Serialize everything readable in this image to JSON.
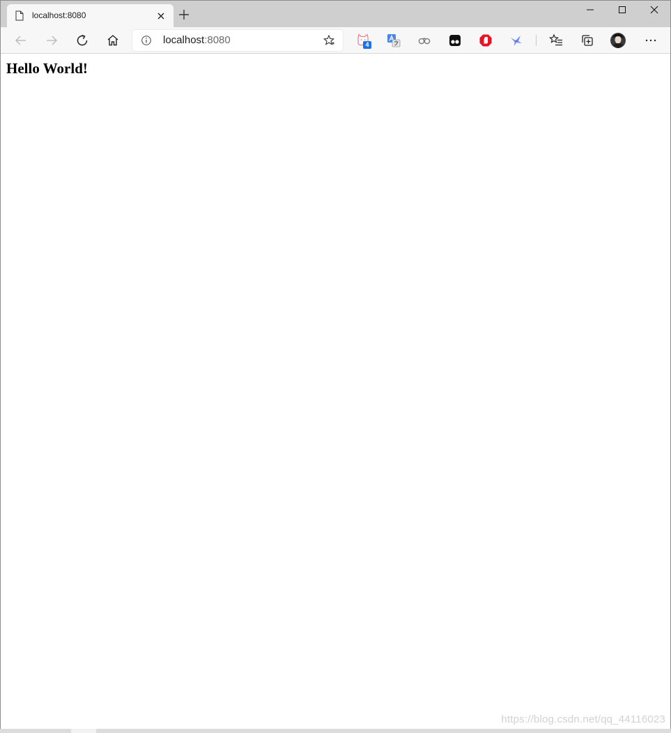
{
  "tab": {
    "title": "localhost:8080"
  },
  "address_bar": {
    "host": "localhost",
    "port": ":8080"
  },
  "extensions": {
    "badge_count": "4"
  },
  "page": {
    "heading": "Hello World!"
  },
  "watermark": "https://blog.csdn.net/qq_44116023",
  "icons": {
    "page": "page-icon",
    "close_tab": "close-icon",
    "new_tab": "plus-icon",
    "minimize": "minimize-icon",
    "maximize": "maximize-icon",
    "close_window": "close-icon",
    "back": "arrow-left-icon",
    "forward": "arrow-right-icon",
    "refresh": "refresh-icon",
    "home": "home-icon",
    "info": "info-icon",
    "favorite": "star-icon",
    "ext_cat": "cat-extension-icon",
    "ext_translate": "translate-extension-icon",
    "ext_gamepad": "gamepad-extension-icon",
    "ext_tampermonkey": "tampermonkey-icon",
    "ext_adblock": "adblock-icon",
    "ext_bird": "bird-extension-icon",
    "favorites": "favorites-icon",
    "collections": "collections-icon",
    "profile": "avatar-icon",
    "menu": "more-icon"
  },
  "colors": {
    "accent": "#1a73e8",
    "adblock_red": "#e81224",
    "tab_bar": "#cfcfcf",
    "toolbar": "#f7f7f7"
  }
}
